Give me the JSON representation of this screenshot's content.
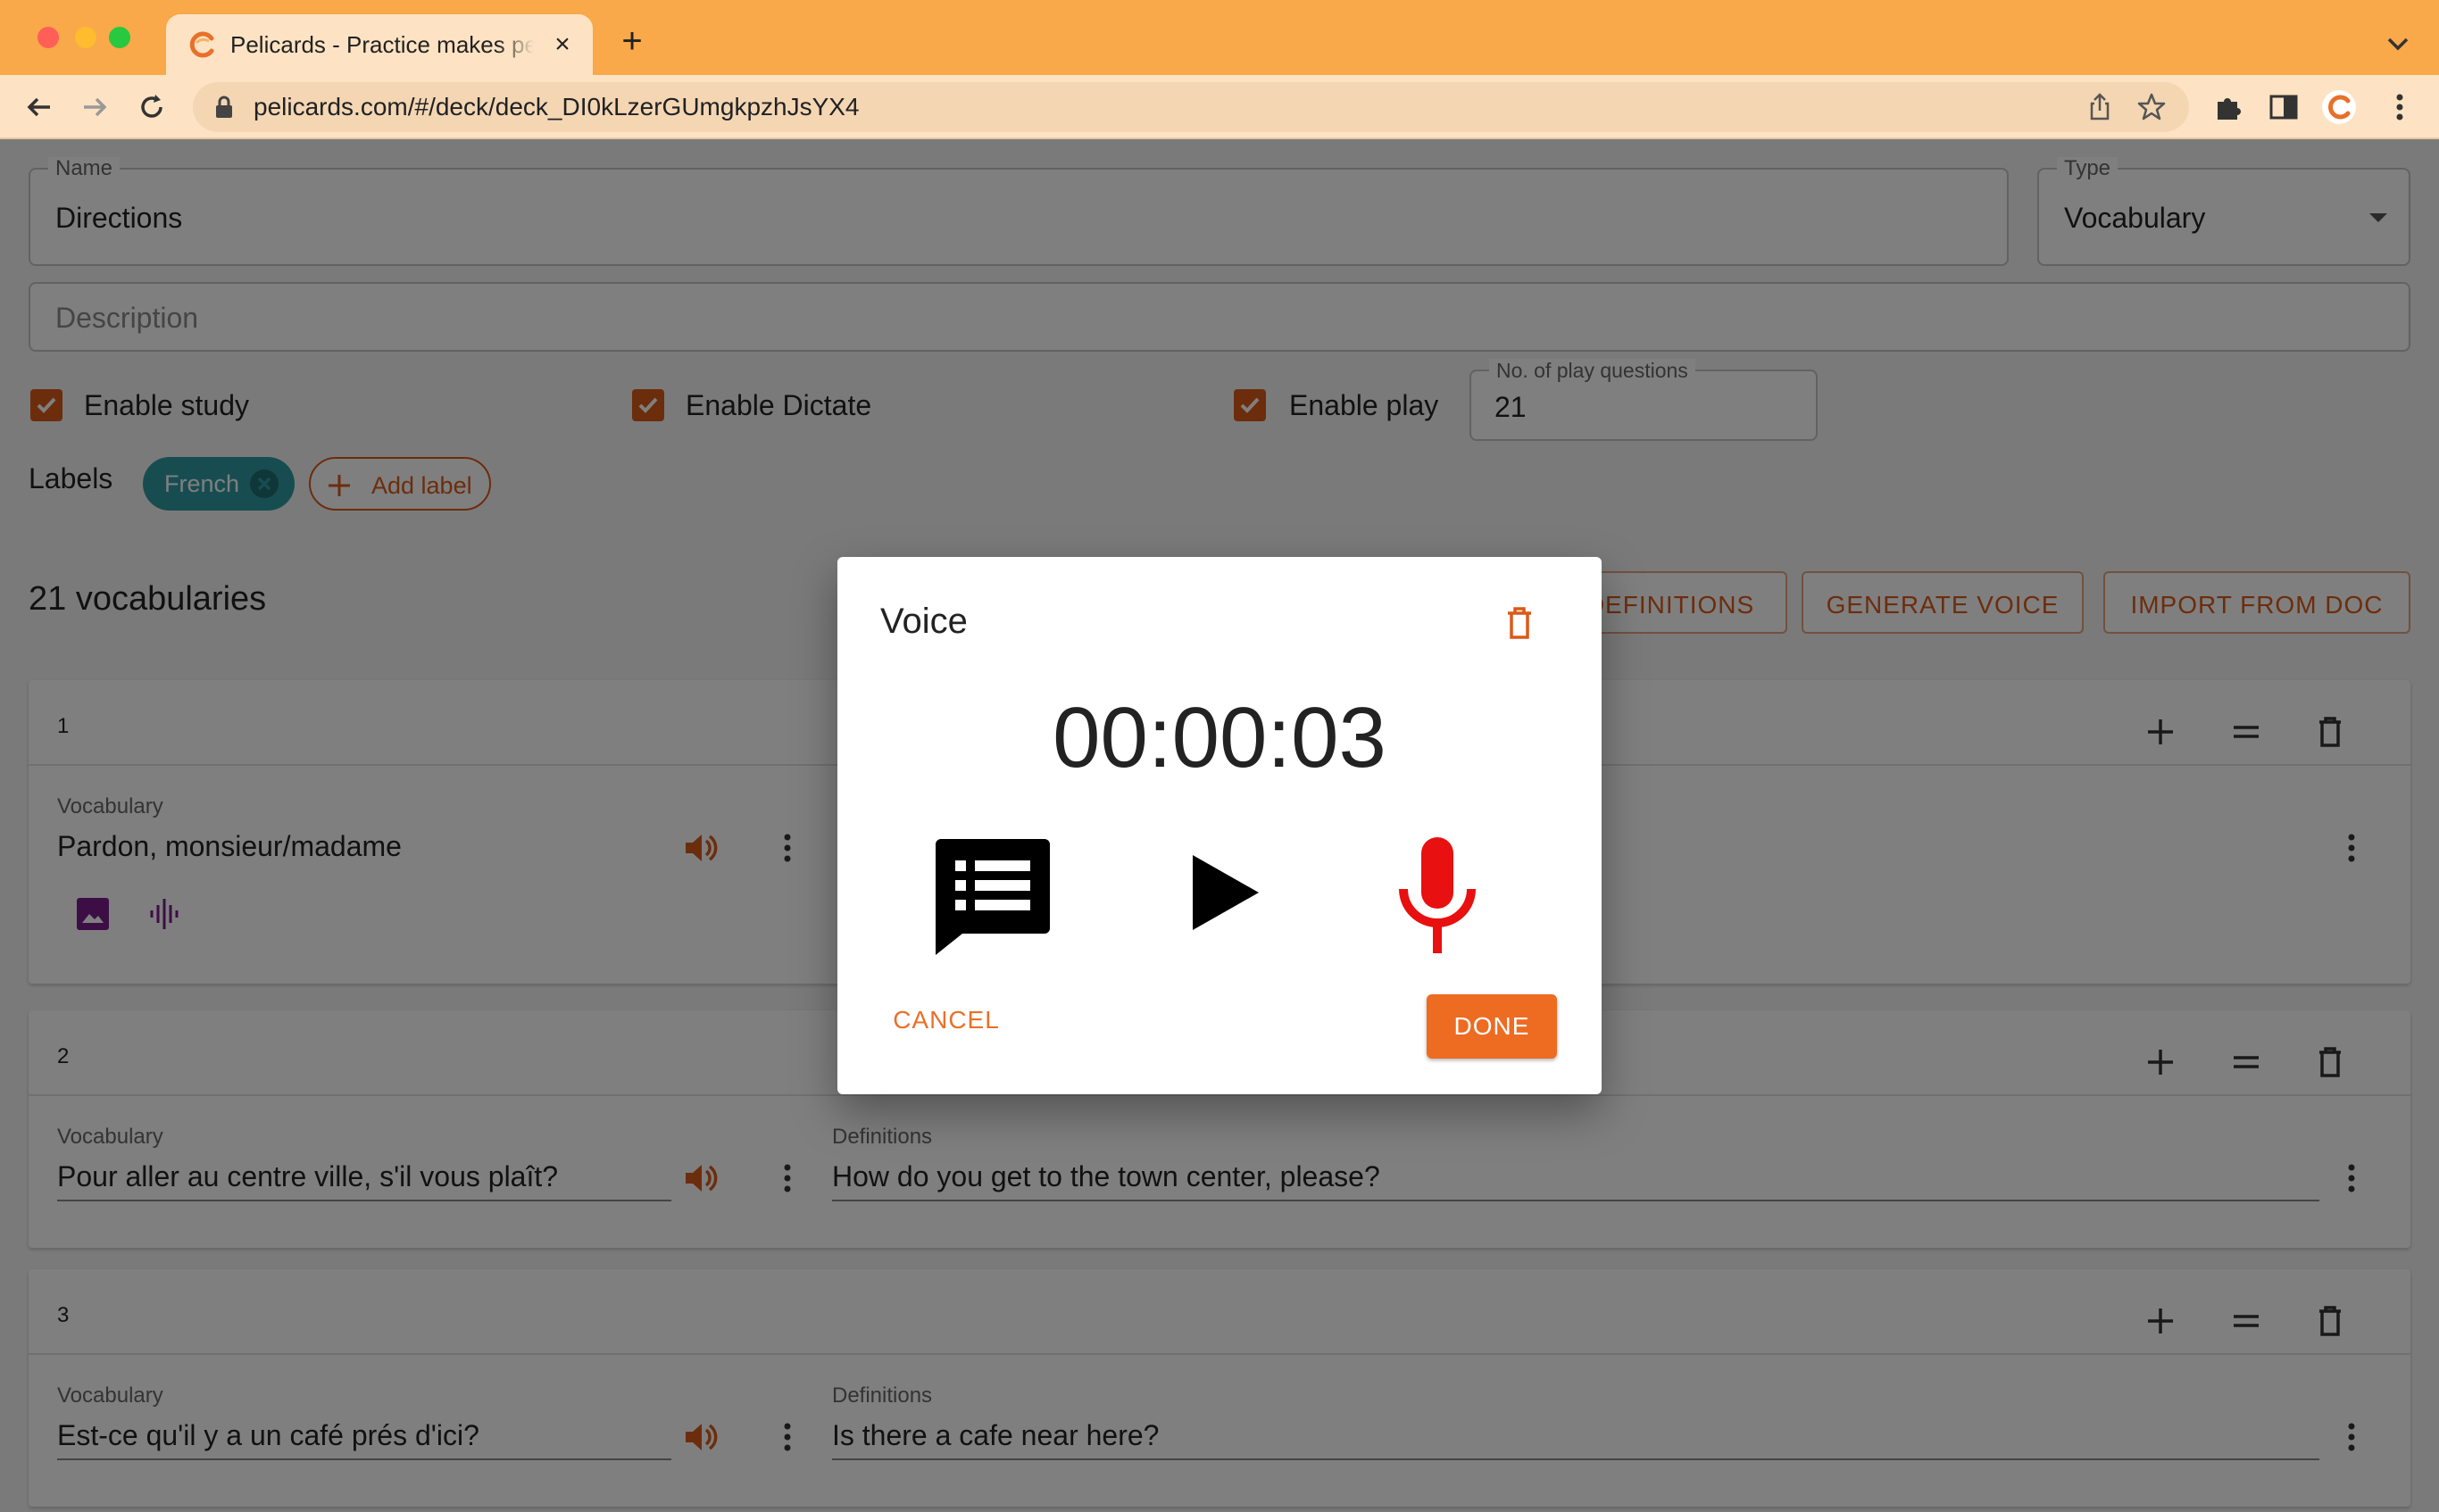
{
  "browser": {
    "tab_title": "Pelicards - Practice makes perfect",
    "url": "pelicards.com/#/deck/deck_DI0kLzerGUmgkpzhJsYX4"
  },
  "deck": {
    "name_label": "Name",
    "name_value": "Directions",
    "type_label": "Type",
    "type_value": "Vocabulary",
    "description_placeholder": "Description",
    "enable_study_label": "Enable study",
    "enable_study": true,
    "enable_dictate_label": "Enable Dictate",
    "enable_dictate": true,
    "enable_play_label": "Enable play",
    "enable_play": true,
    "play_questions_label": "No. of play questions",
    "play_questions_value": "21",
    "labels_title": "Labels",
    "labels": [
      "French"
    ],
    "add_label": "Add label"
  },
  "vocab": {
    "count_title": "21 vocabularies",
    "actions": [
      "DEFINITIONS",
      "GENERATE VOICE",
      "IMPORT FROM DOC"
    ],
    "vocabulary_label": "Vocabulary",
    "definitions_label": "Definitions",
    "cards": [
      {
        "number": "1",
        "vocabulary": "Pardon, monsieur/madame",
        "definition": ""
      },
      {
        "number": "2",
        "vocabulary": "Pour aller au centre ville, s'il vous plaît?",
        "definition": "How do you get to the town center, please?"
      },
      {
        "number": "3",
        "vocabulary": "Est-ce qu'il y a un café prés d'ici?",
        "definition": "Is there a cafe near here?"
      }
    ]
  },
  "dialog": {
    "title": "Voice",
    "timer": "00:00:03",
    "cancel_label": "CANCEL",
    "done_label": "DONE"
  },
  "colors": {
    "accent": "#d95a1a",
    "chrome": "#f9a84a",
    "chip": "#2f9aa0",
    "mic": "#e81010",
    "media_icons": "#7b1d8c"
  }
}
